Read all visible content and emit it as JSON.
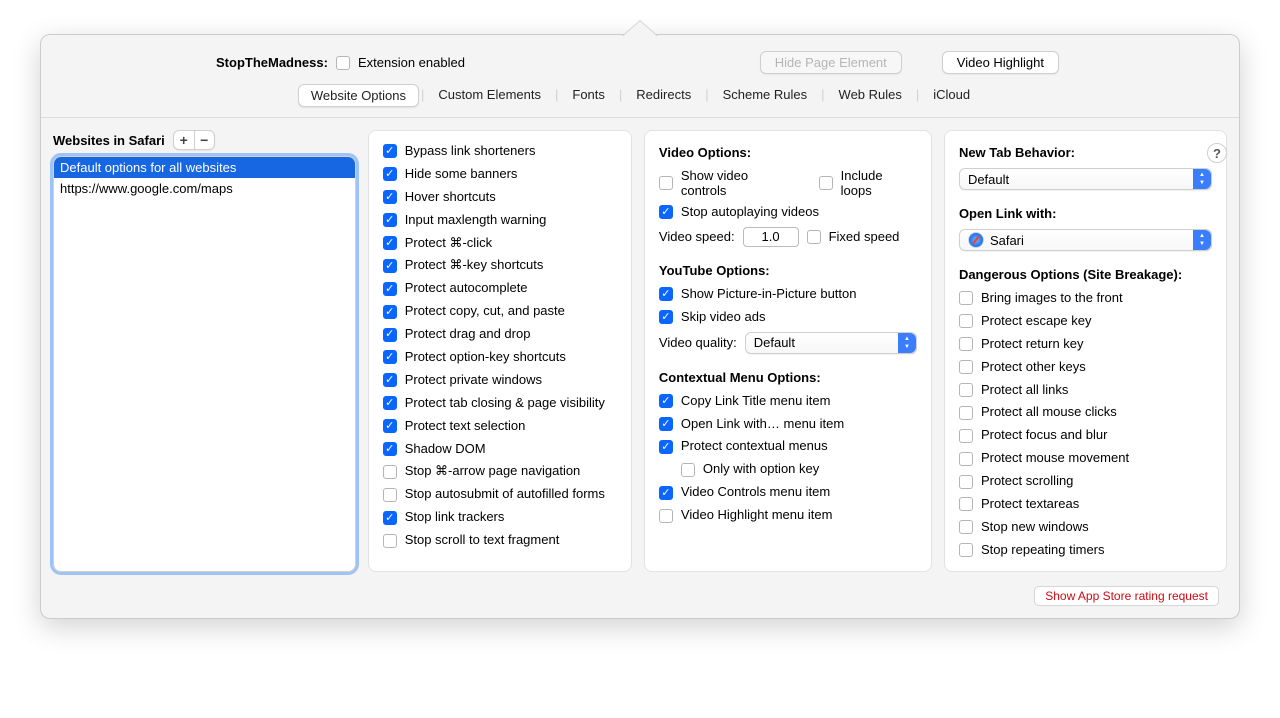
{
  "header": {
    "appLabel": "StopTheMadness:",
    "extensionEnabledLabel": "Extension enabled",
    "extensionEnabledChecked": false,
    "hidePageElementLabel": "Hide Page Element",
    "videoHighlightLabel": "Video Highlight"
  },
  "tabs": [
    "Website Options",
    "Custom Elements",
    "Fonts",
    "Redirects",
    "Scheme Rules",
    "Web Rules",
    "iCloud"
  ],
  "selectedTabIndex": 0,
  "helpLabel": "?",
  "sidebar": {
    "title": "Websites in Safari",
    "plus": "+",
    "minus": "−",
    "items": [
      {
        "label": "Default options for all websites",
        "selected": true
      },
      {
        "label": "https://www.google.com/maps",
        "selected": false
      }
    ]
  },
  "protectOptions": [
    {
      "label": "Bypass link shorteners",
      "checked": true
    },
    {
      "label": "Hide some banners",
      "checked": true
    },
    {
      "label": "Hover shortcuts",
      "checked": true
    },
    {
      "label": "Input maxlength warning",
      "checked": true
    },
    {
      "label": "Protect ⌘-click",
      "checked": true
    },
    {
      "label": "Protect ⌘-key shortcuts",
      "checked": true
    },
    {
      "label": "Protect autocomplete",
      "checked": true
    },
    {
      "label": "Protect copy, cut, and paste",
      "checked": true
    },
    {
      "label": "Protect drag and drop",
      "checked": true
    },
    {
      "label": "Protect option-key shortcuts",
      "checked": true
    },
    {
      "label": "Protect private windows",
      "checked": true
    },
    {
      "label": "Protect tab closing & page visibility",
      "checked": true
    },
    {
      "label": "Protect text selection",
      "checked": true
    },
    {
      "label": "Shadow DOM",
      "checked": true
    },
    {
      "label": "Stop ⌘-arrow page navigation",
      "checked": false
    },
    {
      "label": "Stop autosubmit of autofilled forms",
      "checked": false
    },
    {
      "label": "Stop link trackers",
      "checked": true
    },
    {
      "label": "Stop scroll to text fragment",
      "checked": false
    }
  ],
  "videoSection": {
    "title": "Video Options:",
    "showControls": {
      "label": "Show video controls",
      "checked": false
    },
    "includeLoops": {
      "label": "Include loops",
      "checked": false
    },
    "stopAutoplay": {
      "label": "Stop autoplaying videos",
      "checked": true
    },
    "speedLabel": "Video speed:",
    "speedValue": "1.0",
    "fixedSpeed": {
      "label": "Fixed speed",
      "checked": false
    }
  },
  "youtubeSection": {
    "title": "YouTube Options:",
    "pip": {
      "label": "Show Picture-in-Picture button",
      "checked": true
    },
    "skipAds": {
      "label": "Skip video ads",
      "checked": true
    },
    "qualityLabel": "Video quality:",
    "qualityValue": "Default"
  },
  "contextSection": {
    "title": "Contextual Menu Options:",
    "copyLinkTitle": {
      "label": "Copy Link Title menu item",
      "checked": true
    },
    "openLinkWith": {
      "label": "Open Link with… menu item",
      "checked": true
    },
    "protectContext": {
      "label": "Protect contextual menus",
      "checked": true
    },
    "onlyOption": {
      "label": "Only with option key",
      "checked": false
    },
    "videoControls": {
      "label": "Video Controls menu item",
      "checked": true
    },
    "videoHighlight": {
      "label": "Video Highlight menu item",
      "checked": false
    }
  },
  "rightCol": {
    "newTabTitle": "New Tab Behavior:",
    "newTabValue": "Default",
    "openLinkTitle": "Open Link with:",
    "openLinkValue": "Safari",
    "dangerousTitle": "Dangerous Options (Site Breakage):",
    "dangerous": [
      {
        "label": "Bring images to the front",
        "checked": false
      },
      {
        "label": "Protect escape key",
        "checked": false
      },
      {
        "label": "Protect return key",
        "checked": false
      },
      {
        "label": "Protect other keys",
        "checked": false
      },
      {
        "label": "Protect all links",
        "checked": false
      },
      {
        "label": "Protect all mouse clicks",
        "checked": false
      },
      {
        "label": "Protect focus and blur",
        "checked": false
      },
      {
        "label": "Protect mouse movement",
        "checked": false
      },
      {
        "label": "Protect scrolling",
        "checked": false
      },
      {
        "label": "Protect textareas",
        "checked": false
      },
      {
        "label": "Stop new windows",
        "checked": false
      },
      {
        "label": "Stop repeating timers",
        "checked": false
      }
    ]
  },
  "footer": {
    "ratingRequest": "Show App Store rating request"
  }
}
